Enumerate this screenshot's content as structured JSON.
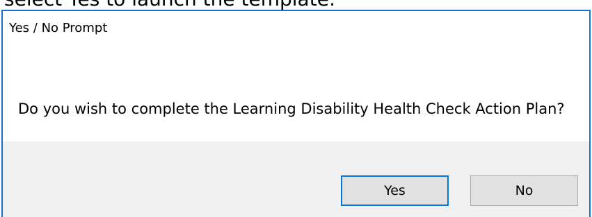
{
  "caption": "select Yes to launch the template:",
  "dialog": {
    "title": "Yes / No Prompt",
    "message": "Do you wish to complete the Learning Disability Health Check Action Plan?",
    "buttons": {
      "yes_label": "Yes",
      "no_label": "No"
    }
  },
  "colors": {
    "window_border": "#1c6fd1",
    "footer_background": "#f0f0f0",
    "button_background": "#e1e1e1",
    "default_button_border": "#0078d7"
  }
}
